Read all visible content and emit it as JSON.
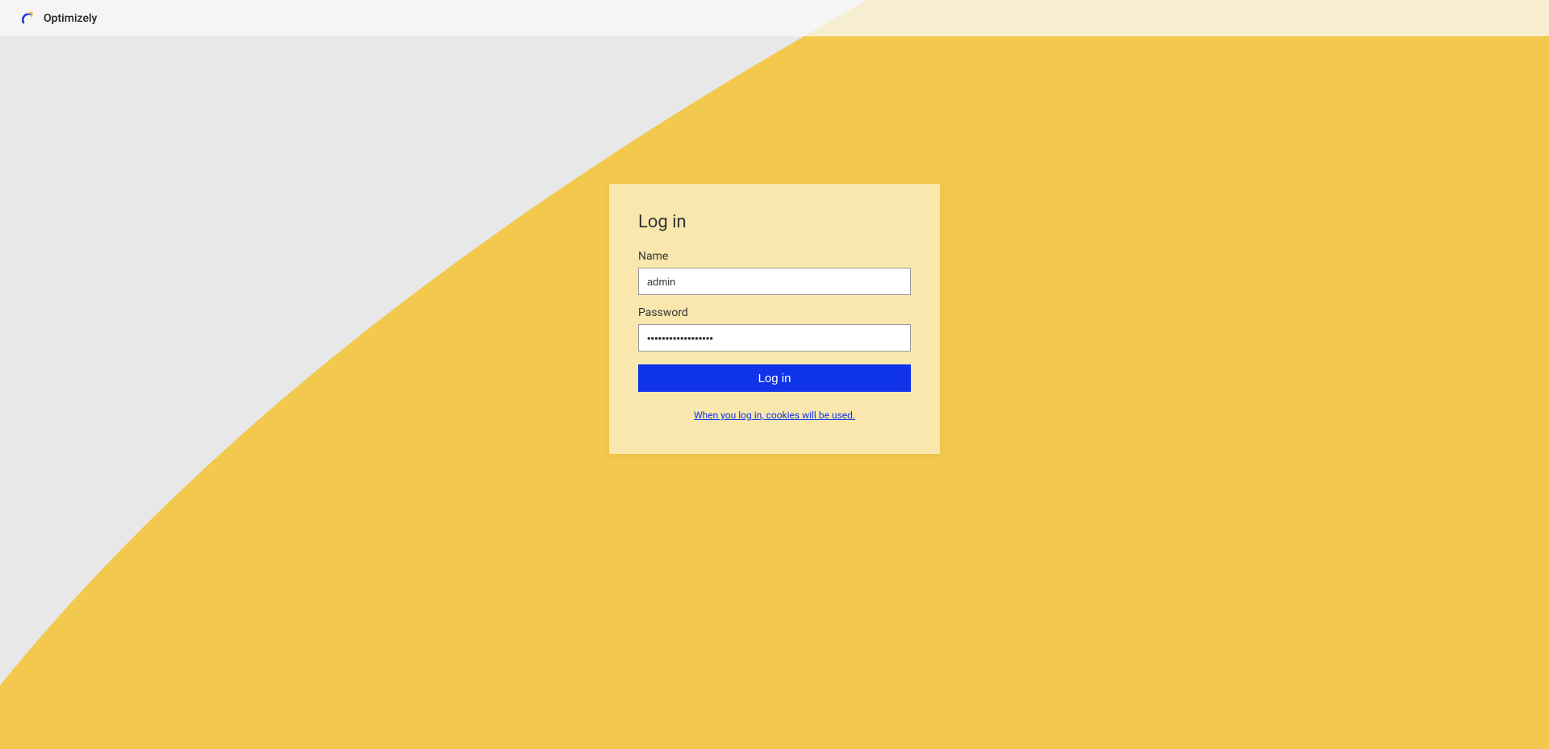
{
  "header": {
    "brand": "Optimizely"
  },
  "login": {
    "title": "Log in",
    "name_label": "Name",
    "name_value": "admin",
    "password_label": "Password",
    "password_value": "••••••••••••••••••",
    "button_label": "Log in",
    "cookie_notice": "When you log in, cookies will be used."
  },
  "colors": {
    "accent_yellow": "#f2c94c",
    "primary_blue": "#0e33e8",
    "bg_gray": "#e8e8e8"
  }
}
